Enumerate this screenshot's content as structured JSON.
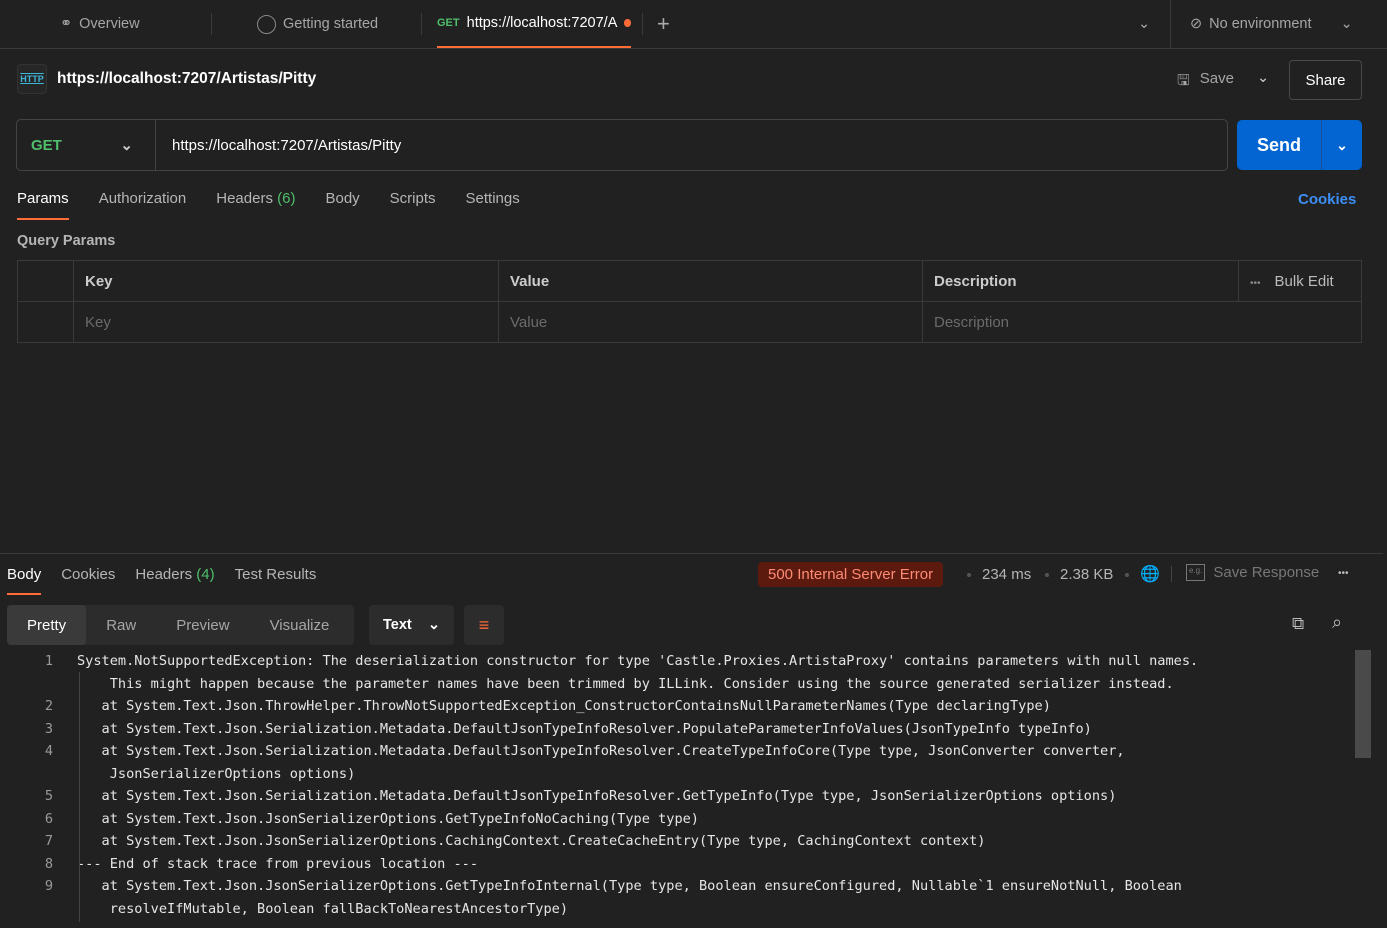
{
  "tabs": [
    {
      "label": "Overview",
      "icon": "overview-icon"
    },
    {
      "label": "Getting started",
      "icon": "getting-started-icon"
    },
    {
      "method": "GET",
      "label": "https://localhost:7207/A",
      "unsaved": true
    }
  ],
  "environment": "No environment",
  "request": {
    "title": "https://localhost:7207/Artistas/Pitty",
    "save": "Save",
    "share": "Share",
    "method": "GET",
    "url": "https://localhost:7207/Artistas/Pitty",
    "send": "Send"
  },
  "req_tabs": {
    "params": "Params",
    "authorization": "Authorization",
    "headers": "Headers",
    "headers_count": "(6)",
    "body": "Body",
    "scripts": "Scripts",
    "settings": "Settings",
    "cookies": "Cookies"
  },
  "query_params": {
    "title": "Query Params",
    "headers": [
      "Key",
      "Value",
      "Description"
    ],
    "bulk_edit": "Bulk Edit",
    "placeholders": [
      "Key",
      "Value",
      "Description"
    ]
  },
  "response": {
    "tabs": {
      "body": "Body",
      "cookies": "Cookies",
      "headers": "Headers",
      "headers_count": "(4)",
      "tests": "Test Results"
    },
    "status": "500 Internal Server Error",
    "time": "234 ms",
    "size": "2.38 KB",
    "save": "Save Response",
    "colors": {
      "accent": "#ff6c37",
      "send": "#0265d2",
      "error": "#ff8b74"
    },
    "views": [
      "Pretty",
      "Raw",
      "Preview",
      "Visualize"
    ],
    "format": "Text",
    "lines": [
      {
        "n": "1",
        "text": "System.NotSupportedException: The deserialization constructor for type 'Castle.Proxies.ArtistaProxy' contains parameters with null names.",
        "wrap": "    This might happen because the parameter names have been trimmed by ILLink. Consider using the source generated serializer instead."
      },
      {
        "n": "2",
        "text": "   at System.Text.Json.ThrowHelper.ThrowNotSupportedException_ConstructorContainsNullParameterNames(Type declaringType)"
      },
      {
        "n": "3",
        "text": "   at System.Text.Json.Serialization.Metadata.DefaultJsonTypeInfoResolver.PopulateParameterInfoValues(JsonTypeInfo typeInfo)"
      },
      {
        "n": "4",
        "text": "   at System.Text.Json.Serialization.Metadata.DefaultJsonTypeInfoResolver.CreateTypeInfoCore(Type type, JsonConverter converter,",
        "wrap": "    JsonSerializerOptions options)"
      },
      {
        "n": "5",
        "text": "   at System.Text.Json.Serialization.Metadata.DefaultJsonTypeInfoResolver.GetTypeInfo(Type type, JsonSerializerOptions options)"
      },
      {
        "n": "6",
        "text": "   at System.Text.Json.JsonSerializerOptions.GetTypeInfoNoCaching(Type type)"
      },
      {
        "n": "7",
        "text": "   at System.Text.Json.JsonSerializerOptions.CachingContext.CreateCacheEntry(Type type, CachingContext context)"
      },
      {
        "n": "8",
        "text": "--- End of stack trace from previous location ---"
      },
      {
        "n": "9",
        "text": "   at System.Text.Json.JsonSerializerOptions.GetTypeInfoInternal(Type type, Boolean ensureConfigured, Nullable`1 ensureNotNull, Boolean",
        "wrap": "    resolveIfMutable, Boolean fallBackToNearestAncestorType)"
      }
    ]
  }
}
